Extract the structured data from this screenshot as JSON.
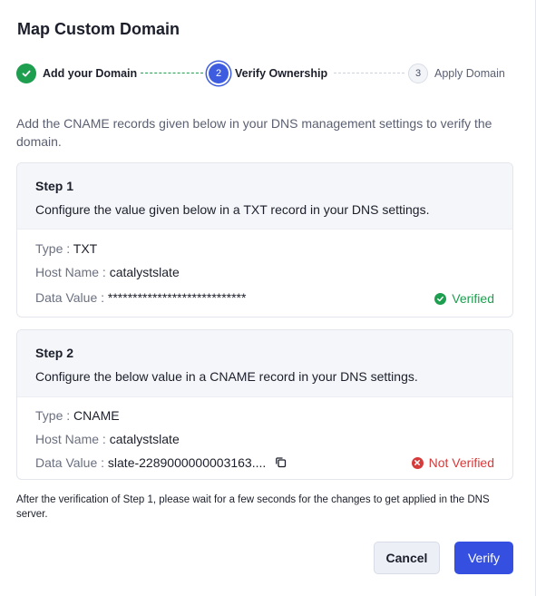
{
  "dialog": {
    "title": "Map Custom Domain"
  },
  "stepper": {
    "steps": [
      {
        "number": "1",
        "label": "Add your Domain",
        "state": "done"
      },
      {
        "number": "2",
        "label": "Verify Ownership",
        "state": "active"
      },
      {
        "number": "3",
        "label": "Apply Domain",
        "state": "pending"
      }
    ]
  },
  "intro": "Add the CNAME records given below in your DNS management settings to verify the domain.",
  "cards": [
    {
      "heading": "Step 1",
      "description": "Configure the value given below in a TXT record in your DNS settings.",
      "type_key": "Type :",
      "type_value": "TXT",
      "host_key": "Host Name :",
      "host_value": "catalystslate",
      "data_key": "Data Value :",
      "data_value": "****************************",
      "status": "Verified"
    },
    {
      "heading": "Step 2",
      "description": "Configure the below value in a CNAME record in your DNS settings.",
      "type_key": "Type :",
      "type_value": "CNAME",
      "host_key": "Host Name :",
      "host_value": "catalystslate",
      "data_key": "Data Value :",
      "data_value": "slate-2289000000003163....",
      "status": "Not Verified"
    }
  ],
  "note": "After the verification of Step 1, please wait for a few seconds for the changes to get applied in the DNS server.",
  "buttons": {
    "cancel": "Cancel",
    "verify": "Verify"
  },
  "colors": {
    "success": "#1e9e4f",
    "error": "#d63a3a",
    "primary": "#3550e0"
  }
}
